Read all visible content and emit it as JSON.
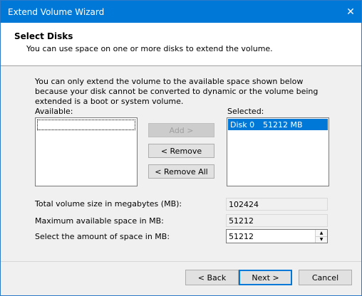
{
  "window": {
    "title": "Extend Volume Wizard",
    "close_glyph": "✕"
  },
  "header": {
    "title": "Select Disks",
    "subtitle": "You can use space on one or more disks to extend the volume."
  },
  "description": "You can only extend the volume to the available space shown below because your disk cannot be converted to dynamic or the volume being extended is a boot or system volume.",
  "available": {
    "label": "Available:"
  },
  "selected": {
    "label": "Selected:",
    "items": [
      {
        "disk": "Disk 0",
        "size": "51212 MB"
      }
    ]
  },
  "buttons": {
    "add": "Add >",
    "remove": "< Remove",
    "remove_all": "< Remove All",
    "back": "< Back",
    "next": "Next >",
    "cancel": "Cancel"
  },
  "fields": {
    "total_label": "Total volume size in megabytes (MB):",
    "total_value": "102424",
    "max_label": "Maximum available space in MB:",
    "max_value": "51212",
    "amount_label": "Select the amount of space in MB:",
    "amount_value": "51212"
  },
  "colors": {
    "accent": "#0078d7"
  },
  "icons": {
    "spin_up": "▲",
    "spin_down": "▼"
  }
}
